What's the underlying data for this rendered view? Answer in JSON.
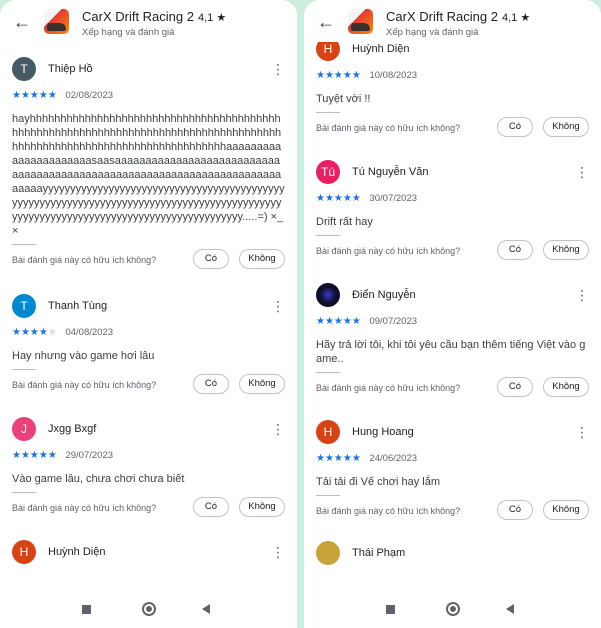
{
  "app": {
    "back_icon": "arrow-left-icon",
    "title": "CarX Drift Racing 2",
    "rating": "4,1 ★",
    "subtitle": "Xếp hạng và đánh giá"
  },
  "helpful": {
    "question": "Bài đánh giá này có hữu ích không?",
    "yes": "Có",
    "no": "Không"
  },
  "left_reviews": [
    {
      "initial": "T",
      "avatar_color": "#455a64",
      "name": "Thiệp Hồ",
      "stars": 5,
      "stars_on": "★★★★★",
      "stars_off": "",
      "date": "02/08/2023",
      "text": "hayhhhhhhhhhhhhhhhhhhhhhhhhhhhhhhhhhhhhhhhhhhhhhhhhhhhhhhhhhhhhhhhhhhhhhhhhhhhhhhhhhhhhhhhhhhhhhhhhhhhhhhhhhhhhhhhhhhhhhhhhaaaaaaaaaaaaaaaaaaaaaasaasaaaaaaaaaaaaaaaaaaaaaaaaaaaaaaaaaaaaaaaaaaaaaaaaaaaaaaaaaaaaaaaaaaaaaaaaaaaayyyyyyyyyyyyyyyyyyyyyyyyyyyyyyyyyyyyyyyyyyyyyyyyyyyyyyyyyyyyyyyyyyyyyyyyyyyyyyyyyyyyyyyyyyyyyyyyyyyyyyyyyyyyyyyyyyyyyyyyyyyyyyyyyyyyyyy.....=) ×_×"
    },
    {
      "initial": "T",
      "avatar_color": "#0288d1",
      "name": "Thanh Tùng",
      "stars": 4,
      "stars_on": "★★★★",
      "stars_off": "★",
      "date": "04/08/2023",
      "text": "Hay nhưng vào game hơi lâu"
    },
    {
      "initial": "J",
      "avatar_color": "#ec407a",
      "name": "Jxgg Bxgf",
      "stars": 5,
      "stars_on": "★★★★★",
      "stars_off": "",
      "date": "29/07/2023",
      "text": "Vào game lâu, chưa chơi chưa biết"
    },
    {
      "initial": "H",
      "avatar_color": "#d84315",
      "name": "Huỳnh Diện"
    }
  ],
  "right_reviews": [
    {
      "initial": "H",
      "avatar_color": "#d84315",
      "name": "Huỳnh Diện",
      "stars": 5,
      "stars_on": "★★★★★",
      "stars_off": "",
      "date": "10/08/2023",
      "text": "Tuyệt vời !!"
    },
    {
      "initial": "Tú",
      "avatar_color": "#e91e63",
      "name": "Tú Nguyễn Văn",
      "stars": 5,
      "stars_on": "★★★★★",
      "stars_off": "",
      "date": "30/07/2023",
      "text": "Drift rất hay"
    },
    {
      "initial": "",
      "avatar_color": "#101030",
      "name": "Điển Nguyễn",
      "stars": 5,
      "stars_on": "★★★★★",
      "stars_off": "",
      "date": "09/07/2023",
      "text": "Hãy trả lời tôi, khi tôi yêu cầu bạn thêm tiếng Việt vào game.."
    },
    {
      "initial": "H",
      "avatar_color": "#d84315",
      "name": "Hung Hoang",
      "stars": 5,
      "stars_on": "★★★★★",
      "stars_off": "",
      "date": "24/06/2023",
      "text": "Tải tải đi Vế chơi hay lắm"
    },
    {
      "initial": "",
      "avatar_color": "#c9a23a",
      "name": "Thái Phạm"
    }
  ],
  "navbar": {
    "recents_icon": "square-icon",
    "home_icon": "circle-icon",
    "back_icon": "triangle-back-icon"
  }
}
